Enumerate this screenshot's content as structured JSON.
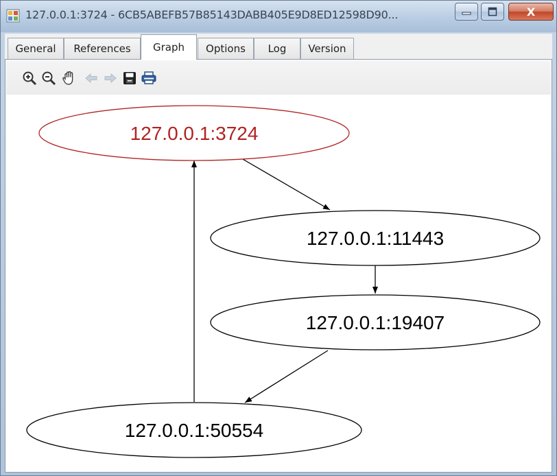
{
  "window": {
    "title": "127.0.0.1:3724 - 6CB5ABEFB57B85143DABB405E9D8ED12598D90...",
    "app_icon": "app-window-icon",
    "controls": {
      "minimize_icon": "minimize-icon",
      "maximize_icon": "maximize-icon",
      "close_label": "X"
    }
  },
  "tabs": [
    {
      "label": "General",
      "active": false
    },
    {
      "label": "References",
      "active": false
    },
    {
      "label": "Graph",
      "active": true
    },
    {
      "label": "Options",
      "active": false
    },
    {
      "label": "Log",
      "active": false
    },
    {
      "label": "Version",
      "active": false
    }
  ],
  "toolbar": {
    "tools": [
      {
        "icon": "zoom-in-icon",
        "enabled": true
      },
      {
        "icon": "zoom-out-icon",
        "enabled": true
      },
      {
        "icon": "pan-hand-icon",
        "enabled": true
      },
      {
        "icon": "back-arrow-icon",
        "enabled": false
      },
      {
        "icon": "forward-arrow-icon",
        "enabled": false
      },
      {
        "icon": "save-icon",
        "enabled": true
      },
      {
        "icon": "print-icon",
        "enabled": true
      }
    ]
  },
  "graph": {
    "nodes": [
      {
        "id": "n3724",
        "label": "127.0.0.1:3724",
        "highlighted": true
      },
      {
        "id": "n11443",
        "label": "127.0.0.1:11443",
        "highlighted": false
      },
      {
        "id": "n19407",
        "label": "127.0.0.1:19407",
        "highlighted": false
      },
      {
        "id": "n50554",
        "label": "127.0.0.1:50554",
        "highlighted": false
      }
    ],
    "edges": [
      {
        "from": "n3724",
        "to": "n11443"
      },
      {
        "from": "n11443",
        "to": "n19407"
      },
      {
        "from": "n19407",
        "to": "n50554"
      },
      {
        "from": "n50554",
        "to": "n3724"
      }
    ],
    "colors": {
      "highlight": "#b22222",
      "normal": "#000000"
    }
  }
}
